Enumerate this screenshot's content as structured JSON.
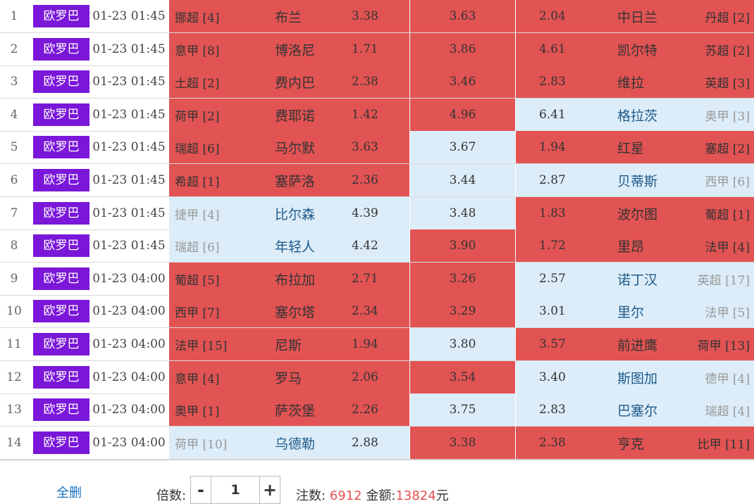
{
  "matches": [
    {
      "num": "1",
      "league": "欧罗巴",
      "time": "01-23 01:45",
      "home_rank": "挪超 [4]",
      "home": "布兰",
      "home_odd": "3.38",
      "draw_odd": "3.63",
      "away_odd": "2.04",
      "away": "中日兰",
      "away_rank": "丹超 [2]",
      "home_c": "red",
      "draw_c": "red",
      "away_c": "red"
    },
    {
      "num": "2",
      "league": "欧罗巴",
      "time": "01-23 01:45",
      "home_rank": "意甲 [8]",
      "home": "博洛尼",
      "home_odd": "1.71",
      "draw_odd": "3.86",
      "away_odd": "4.61",
      "away": "凯尔特",
      "away_rank": "苏超 [2]",
      "home_c": "red",
      "draw_c": "red",
      "away_c": "red"
    },
    {
      "num": "3",
      "league": "欧罗巴",
      "time": "01-23 01:45",
      "home_rank": "土超 [2]",
      "home": "费内巴",
      "home_odd": "2.38",
      "draw_odd": "3.46",
      "away_odd": "2.83",
      "away": "维拉",
      "away_rank": "英超 [3]",
      "home_c": "red",
      "draw_c": "red",
      "away_c": "red"
    },
    {
      "num": "4",
      "league": "欧罗巴",
      "time": "01-23 01:45",
      "home_rank": "荷甲 [2]",
      "home": "费耶诺",
      "home_odd": "1.42",
      "draw_odd": "4.96",
      "away_odd": "6.41",
      "away": "格拉茨",
      "away_rank": "奥甲 [3]",
      "home_c": "red",
      "draw_c": "red",
      "away_c": "blue"
    },
    {
      "num": "5",
      "league": "欧罗巴",
      "time": "01-23 01:45",
      "home_rank": "瑞超 [6]",
      "home": "马尔默",
      "home_odd": "3.63",
      "draw_odd": "3.67",
      "away_odd": "1.94",
      "away": "红星",
      "away_rank": "塞超 [2]",
      "home_c": "red",
      "draw_c": "blue",
      "away_c": "red"
    },
    {
      "num": "6",
      "league": "欧罗巴",
      "time": "01-23 01:45",
      "home_rank": "希超 [1]",
      "home": "塞萨洛",
      "home_odd": "2.36",
      "draw_odd": "3.44",
      "away_odd": "2.87",
      "away": "贝蒂斯",
      "away_rank": "西甲 [6]",
      "home_c": "red",
      "draw_c": "blue",
      "away_c": "blue"
    },
    {
      "num": "7",
      "league": "欧罗巴",
      "time": "01-23 01:45",
      "home_rank": "捷甲 [4]",
      "home": "比尔森",
      "home_odd": "4.39",
      "draw_odd": "3.48",
      "away_odd": "1.83",
      "away": "波尔图",
      "away_rank": "葡超 [1]",
      "home_c": "blue",
      "draw_c": "blue",
      "away_c": "red"
    },
    {
      "num": "8",
      "league": "欧罗巴",
      "time": "01-23 01:45",
      "home_rank": "瑞超 [6]",
      "home": "年轻人",
      "home_odd": "4.42",
      "draw_odd": "3.90",
      "away_odd": "1.72",
      "away": "里昂",
      "away_rank": "法甲 [4]",
      "home_c": "blue",
      "draw_c": "red",
      "away_c": "red"
    },
    {
      "num": "9",
      "league": "欧罗巴",
      "time": "01-23 04:00",
      "home_rank": "葡超 [5]",
      "home": "布拉加",
      "home_odd": "2.71",
      "draw_odd": "3.26",
      "away_odd": "2.57",
      "away": "诺丁汉",
      "away_rank": "英超 [17]",
      "home_c": "red",
      "draw_c": "red",
      "away_c": "blue"
    },
    {
      "num": "10",
      "league": "欧罗巴",
      "time": "01-23 04:00",
      "home_rank": "西甲 [7]",
      "home": "塞尔塔",
      "home_odd": "2.34",
      "draw_odd": "3.29",
      "away_odd": "3.01",
      "away": "里尔",
      "away_rank": "法甲 [5]",
      "home_c": "red",
      "draw_c": "red",
      "away_c": "blue"
    },
    {
      "num": "11",
      "league": "欧罗巴",
      "time": "01-23 04:00",
      "home_rank": "法甲 [15]",
      "home": "尼斯",
      "home_odd": "1.94",
      "draw_odd": "3.80",
      "away_odd": "3.57",
      "away": "前进鹰",
      "away_rank": "荷甲 [13]",
      "home_c": "red",
      "draw_c": "blue",
      "away_c": "red"
    },
    {
      "num": "12",
      "league": "欧罗巴",
      "time": "01-23 04:00",
      "home_rank": "意甲 [4]",
      "home": "罗马",
      "home_odd": "2.06",
      "draw_odd": "3.54",
      "away_odd": "3.40",
      "away": "斯图加",
      "away_rank": "德甲 [4]",
      "home_c": "red",
      "draw_c": "red",
      "away_c": "blue"
    },
    {
      "num": "13",
      "league": "欧罗巴",
      "time": "01-23 04:00",
      "home_rank": "奥甲 [1]",
      "home": "萨茨堡",
      "home_odd": "2.26",
      "draw_odd": "3.75",
      "away_odd": "2.83",
      "away": "巴塞尔",
      "away_rank": "瑞超 [4]",
      "home_c": "red",
      "draw_c": "blue",
      "away_c": "blue"
    },
    {
      "num": "14",
      "league": "欧罗巴",
      "time": "01-23 04:00",
      "home_rank": "荷甲 [10]",
      "home": "乌德勒",
      "home_odd": "2.88",
      "draw_odd": "3.38",
      "away_odd": "2.38",
      "away": "亨克",
      "away_rank": "比甲 [11]",
      "home_c": "blue",
      "draw_c": "red",
      "away_c": "red"
    }
  ],
  "footer": {
    "clear_label": "全删",
    "multiplier_label": "倍数:",
    "minus": "-",
    "multiplier_value": "1",
    "plus": "+",
    "bets_label": "注数:",
    "bets_value": "6912",
    "amount_label": "金额:",
    "amount_value": "13824",
    "currency": "元"
  },
  "colors": {
    "selected": "#e25353",
    "unselected": "#dcedf9",
    "league_badge": "#7a17d9"
  }
}
